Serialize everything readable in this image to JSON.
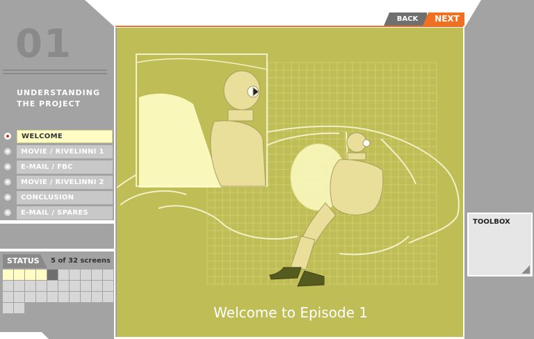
{
  "episode": {
    "number": "01",
    "section_title": "UNDERSTANDING\nTHE PROJECT"
  },
  "nav": {
    "items": [
      {
        "label": "WELCOME",
        "active": true
      },
      {
        "label": "MOVIE / RIVELINNI 1",
        "active": false
      },
      {
        "label": "E-MAIL / FBC",
        "active": false
      },
      {
        "label": "MOVIE / RIVELINNI 2",
        "active": false
      },
      {
        "label": "CONCLUSION",
        "active": false
      },
      {
        "label": "E-MAIL / SPARES",
        "active": false
      }
    ]
  },
  "status": {
    "label": "STATUS",
    "count": "5 of 32 screens",
    "visited": 4,
    "current_index": 4,
    "total": 32
  },
  "top_nav": {
    "back_label": "BACK",
    "next_label": "NEXT"
  },
  "main": {
    "title": "Welcome to Episode 1"
  },
  "toolbox": {
    "label": "TOOLBOX"
  },
  "colors": {
    "accent": "#f07021",
    "stage": "#bfbd55",
    "panel": "#a3a3a3",
    "highlight": "#fffdc4"
  }
}
